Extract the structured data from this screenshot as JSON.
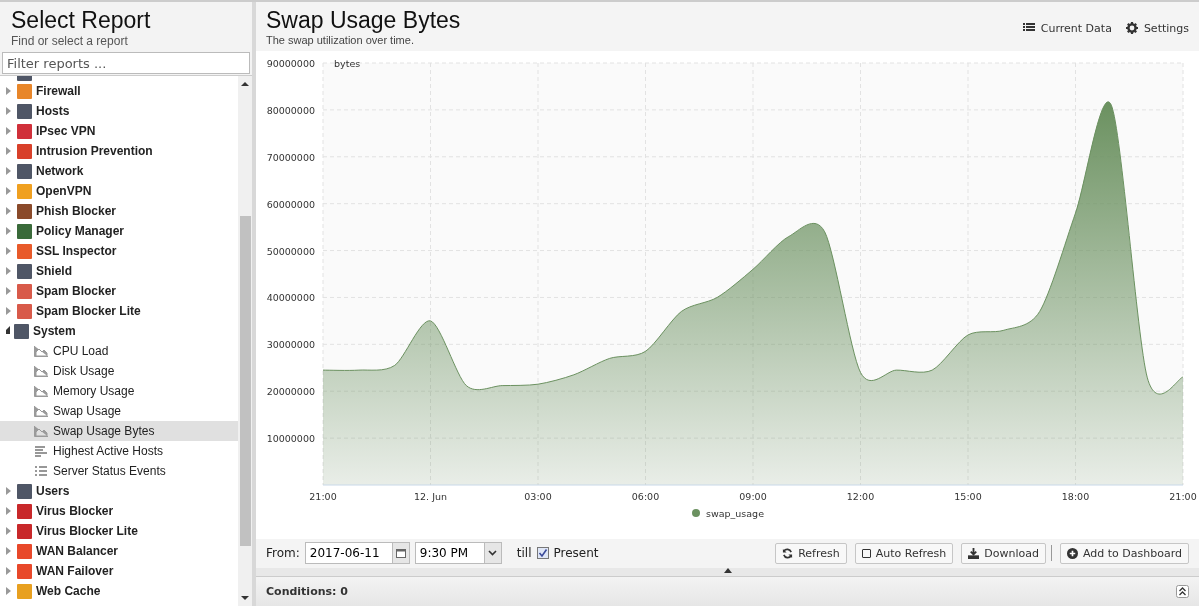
{
  "sidebar": {
    "title": "Select Report",
    "subtitle": "Find or select a report",
    "filter": {
      "placeholder": "Filter reports ..."
    },
    "items": [
      {
        "label": "Firewall",
        "color": "#e8862a",
        "expanded": false
      },
      {
        "label": "Hosts",
        "color": "#4f5666",
        "expanded": false
      },
      {
        "label": "IPsec VPN",
        "color": "#d0303a",
        "expanded": false
      },
      {
        "label": "Intrusion Prevention",
        "color": "#d8402a",
        "expanded": false
      },
      {
        "label": "Network",
        "color": "#4f5666",
        "expanded": false
      },
      {
        "label": "OpenVPN",
        "color": "#f0a020",
        "expanded": false
      },
      {
        "label": "Phish Blocker",
        "color": "#8a4a2a",
        "expanded": false
      },
      {
        "label": "Policy Manager",
        "color": "#3a6a3a",
        "expanded": false
      },
      {
        "label": "SSL Inspector",
        "color": "#e85a2a",
        "expanded": false
      },
      {
        "label": "Shield",
        "color": "#4f5666",
        "expanded": false
      },
      {
        "label": "Spam Blocker",
        "color": "#d85a4a",
        "expanded": false
      },
      {
        "label": "Spam Blocker Lite",
        "color": "#d85a4a",
        "expanded": false
      },
      {
        "label": "System",
        "color": "#4f5666",
        "expanded": true,
        "children": [
          {
            "label": "CPU Load",
            "kind": "area",
            "selected": false
          },
          {
            "label": "Disk Usage",
            "kind": "area",
            "selected": false
          },
          {
            "label": "Memory Usage",
            "kind": "area",
            "selected": false
          },
          {
            "label": "Swap Usage",
            "kind": "area",
            "selected": false
          },
          {
            "label": "Swap Usage Bytes",
            "kind": "area",
            "selected": true
          },
          {
            "label": "Highest Active Hosts",
            "kind": "bars",
            "selected": false
          },
          {
            "label": "Server Status Events",
            "kind": "list",
            "selected": false
          }
        ]
      },
      {
        "label": "Users",
        "color": "#4f5666",
        "expanded": false
      },
      {
        "label": "Virus Blocker",
        "color": "#c8282a",
        "expanded": false
      },
      {
        "label": "Virus Blocker Lite",
        "color": "#c8282a",
        "expanded": false
      },
      {
        "label": "WAN Balancer",
        "color": "#e8482a",
        "expanded": false
      },
      {
        "label": "WAN Failover",
        "color": "#e8482a",
        "expanded": false
      },
      {
        "label": "Web Cache",
        "color": "#e8a020",
        "expanded": false
      }
    ]
  },
  "report": {
    "title": "Swap Usage Bytes",
    "description": "The swap utilization over time.",
    "actions": [
      {
        "label": "Current Data",
        "kind": "list"
      },
      {
        "label": "Settings",
        "kind": "gear"
      }
    ],
    "chart_data": {
      "type": "area",
      "ylabel": "bytes",
      "categories": [
        "21:00",
        null,
        null,
        "12. Jun",
        null,
        null,
        "03:00",
        null,
        null,
        "06:00",
        null,
        null,
        "09:00",
        null,
        null,
        "12:00",
        null,
        null,
        "15:00",
        null,
        null,
        "18:00",
        null,
        null,
        "21:00"
      ],
      "series": [
        {
          "name": "swap_usage",
          "color": "#6b9160",
          "values": [
            24500000,
            24500000,
            25500000,
            35000000,
            21200000,
            21200000,
            21500000,
            23500000,
            27000000,
            28500000,
            37000000,
            40000000,
            46000000,
            53000000,
            54000000,
            24000000,
            24500000,
            24500000,
            32000000,
            33000000,
            37000000,
            58000000,
            81000000,
            23000000,
            23000000
          ]
        }
      ],
      "ylim": [
        0,
        90000000
      ],
      "grid": true,
      "yticks": [
        10000000,
        20000000,
        30000000,
        40000000,
        50000000,
        60000000,
        70000000,
        80000000,
        90000000
      ]
    }
  },
  "toolbar": {
    "from_label": "From:",
    "date": "2017-06-11",
    "time": "9:30 PM",
    "till_label": "till",
    "present": {
      "label": "Present",
      "checked": true
    },
    "buttons": [
      {
        "label": "Refresh",
        "kind": "refresh"
      },
      {
        "label": "Auto Refresh",
        "kind": "checkbox",
        "checked": false
      },
      {
        "label": "Download",
        "kind": "download"
      },
      {
        "label": "Add to Dashboard",
        "kind": "add"
      }
    ]
  },
  "conditions": {
    "label": "Conditions: 0"
  }
}
